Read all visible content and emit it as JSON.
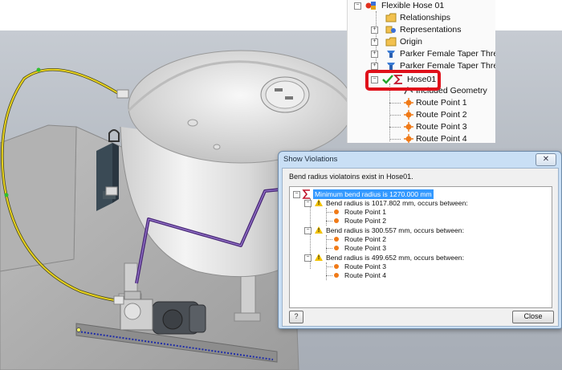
{
  "colors": {
    "highlight_red": "#e0101a",
    "route_point_orange": "#f07a18",
    "hose_yellow": "#e8d21f",
    "selection_blue": "#3399ff",
    "checkmark_green": "#22a52a"
  },
  "browser": {
    "items": [
      {
        "label": "Flexible Hose 01",
        "icon": "assembly-icon"
      },
      {
        "label": "Relationships",
        "icon": "folder-icon"
      },
      {
        "label": "Representations",
        "icon": "representations-icon"
      },
      {
        "label": "Origin",
        "icon": "folder-icon"
      },
      {
        "label": "Parker Female Taper Threa",
        "icon": "fitting-icon"
      },
      {
        "label": "Parker Female Taper Threa",
        "icon": "fitting-icon"
      },
      {
        "label": "Hose01",
        "icon": "sigma-icon"
      },
      {
        "label": "Included Geometry",
        "icon": "geometry-icon"
      },
      {
        "label": "Route Point 1",
        "icon": "route-point-icon"
      },
      {
        "label": "Route Point 2",
        "icon": "route-point-icon"
      },
      {
        "label": "Route Point 3",
        "icon": "route-point-icon"
      },
      {
        "label": "Route Point 4",
        "icon": "route-point-icon"
      }
    ]
  },
  "dialog": {
    "title": "Show Violations",
    "close_x": "✕",
    "message": "Bend radius violatoins exist in Hose01.",
    "tree": {
      "root": "Minimum bend radius is 1270.000 mm",
      "violations": [
        {
          "label": "Bend radius is 1017.802 mm, occurs between:",
          "points": [
            "Route Point 1",
            "Route Point 2"
          ]
        },
        {
          "label": "Bend radius is 300.557 mm, occurs between:",
          "points": [
            "Route Point 2",
            "Route Point 3"
          ]
        },
        {
          "label": "Bend radius is 499.652 mm, occurs between:",
          "points": [
            "Route Point 3",
            "Route Point 4"
          ]
        }
      ]
    },
    "help_label": "?",
    "close_label": "Close"
  }
}
